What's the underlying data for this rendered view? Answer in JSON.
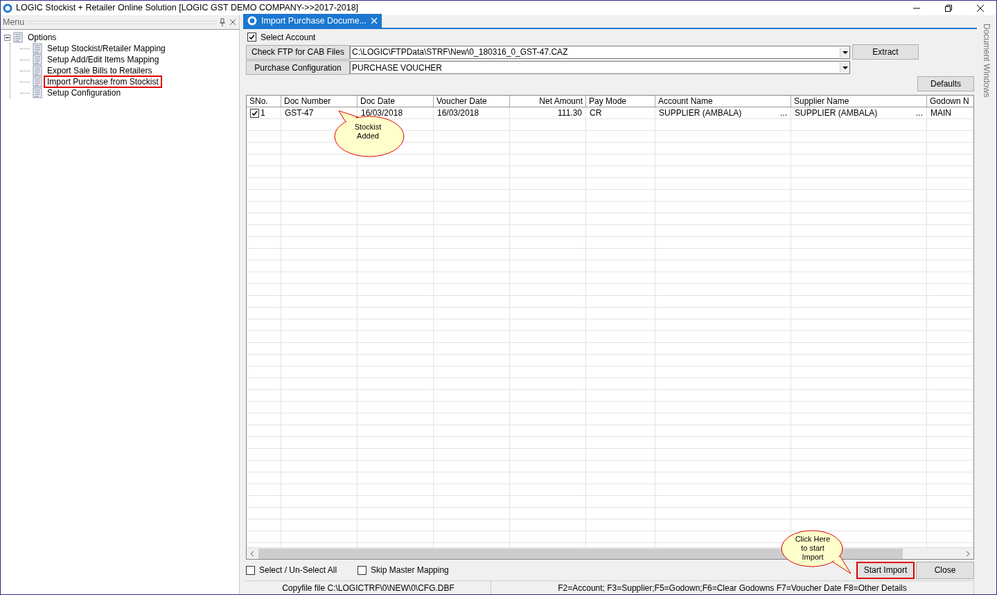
{
  "window": {
    "title": "LOGIC Stockist + Retailer Online Solution [LOGIC GST DEMO COMPANY->>2017-2018]"
  },
  "menu_panel": {
    "title": "Menu",
    "tree": [
      {
        "label": "Options",
        "expanded": true,
        "highlighted": false,
        "children": [
          {
            "label": "Setup Stockist/Retailer Mapping",
            "highlighted": false
          },
          {
            "label": "Setup Add/Edit Items Mapping",
            "highlighted": false
          },
          {
            "label": "Export Sale Bills to Retailers",
            "highlighted": false
          },
          {
            "label": "Import Purchase from Stockist",
            "highlighted": true
          },
          {
            "label": "Setup Configuration",
            "highlighted": false
          }
        ]
      }
    ]
  },
  "document_tab": {
    "label": "Import Purchase Docume...",
    "selected": true
  },
  "select_account": {
    "label": "Select Account",
    "checked": true
  },
  "ftp_row": {
    "button": "Check FTP for CAB Files",
    "value": "C:\\LOGIC\\FTPData\\STRF\\New\\0_180316_0_GST-47.CAZ",
    "action": "Extract"
  },
  "config_row": {
    "button": "Purchase Configuration",
    "value": "PURCHASE VOUCHER"
  },
  "defaults_button": "Defaults",
  "table": {
    "columns": [
      {
        "label": "SNo.",
        "kind": "text"
      },
      {
        "label": "Doc Number",
        "kind": "text"
      },
      {
        "label": "Doc Date",
        "kind": "text"
      },
      {
        "label": "Voucher Date",
        "kind": "text"
      },
      {
        "label": "Net Amount",
        "kind": "number"
      },
      {
        "label": "Pay Mode",
        "kind": "text"
      },
      {
        "label": "Account Name",
        "kind": "text"
      },
      {
        "label": "Supplier Name",
        "kind": "text"
      },
      {
        "label": "Godown N",
        "kind": "text"
      }
    ],
    "rows": [
      {
        "checked": true,
        "cells": [
          {
            "text": "1"
          },
          {
            "text": "GST-47"
          },
          {
            "text": "16/03/2018"
          },
          {
            "text": "16/03/2018"
          },
          {
            "text": "111.30"
          },
          {
            "text": "CR"
          },
          {
            "text": "SUPPLIER (AMBALA)",
            "button": "..."
          },
          {
            "text": "SUPPLIER (AMBALA)",
            "button": "..."
          },
          {
            "text": "MAIN"
          }
        ]
      }
    ]
  },
  "callouts": [
    {
      "lines": [
        "Stockist",
        "Added"
      ]
    },
    {
      "lines": [
        "Click Here",
        "to start",
        "Import"
      ]
    }
  ],
  "select_all": {
    "label": "Select / Un-Select All",
    "checked": false
  },
  "skip_master": {
    "label": "Skip Master Mapping",
    "checked": false
  },
  "buttons": [
    {
      "label": "Start Import",
      "highlighted": true
    },
    {
      "label": "Close",
      "highlighted": false
    }
  ],
  "status_bar": [
    "Copyfile file C:\\LOGICTRF\\0\\NEW\\0\\CFG.DBF",
    "F2=Account; F3=Supplier;F5=Godown;F6=Clear Godowns F7=Voucher Date F8=Other Details"
  ],
  "side_strip": "Document Windows"
}
